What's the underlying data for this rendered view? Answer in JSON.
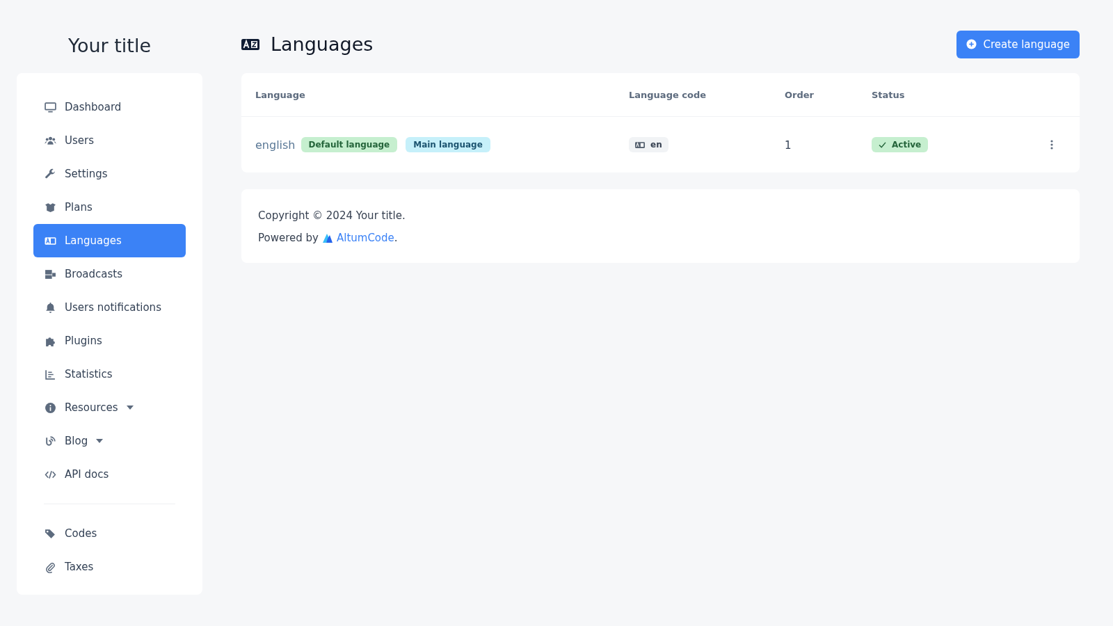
{
  "brand": {
    "title": "Your title"
  },
  "sidebar": {
    "sections": [
      {
        "items": [
          {
            "label": "Dashboard",
            "selected": false,
            "has_submenu": false
          },
          {
            "label": "Users",
            "selected": false,
            "has_submenu": false
          },
          {
            "label": "Settings",
            "selected": false,
            "has_submenu": false
          },
          {
            "label": "Plans",
            "selected": false,
            "has_submenu": false
          },
          {
            "label": "Languages",
            "selected": true,
            "has_submenu": false
          },
          {
            "label": "Broadcasts",
            "selected": false,
            "has_submenu": false
          },
          {
            "label": "Users notifications",
            "selected": false,
            "has_submenu": false
          },
          {
            "label": "Plugins",
            "selected": false,
            "has_submenu": false
          },
          {
            "label": "Statistics",
            "selected": false,
            "has_submenu": false
          },
          {
            "label": "Resources",
            "selected": false,
            "has_submenu": true
          },
          {
            "label": "Blog",
            "selected": false,
            "has_submenu": true
          },
          {
            "label": "API docs",
            "selected": false,
            "has_submenu": false
          }
        ]
      },
      {
        "items": [
          {
            "label": "Codes",
            "selected": false,
            "has_submenu": false
          },
          {
            "label": "Taxes",
            "selected": false,
            "has_submenu": false
          }
        ]
      }
    ]
  },
  "header": {
    "title": "Languages",
    "create_button": "Create language"
  },
  "table": {
    "columns": [
      "Language",
      "Language code",
      "Order",
      "Status"
    ],
    "rows": [
      {
        "language": "english",
        "badges": [
          {
            "label": "Default language",
            "kind": "success"
          },
          {
            "label": "Main language",
            "kind": "info"
          }
        ],
        "code": "en",
        "order": "1",
        "status": "Active",
        "active": true
      }
    ]
  },
  "footer": {
    "copyright": "Copyright © 2024 Your title.",
    "powered_by": "Powered by",
    "link": "AltumCode",
    "link_suffix": "."
  }
}
